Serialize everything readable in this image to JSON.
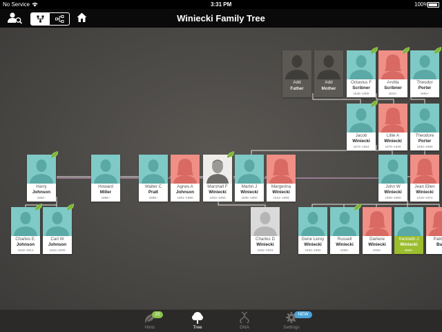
{
  "status_bar": {
    "carrier": "No Service",
    "time": "3:31 PM",
    "battery": "100%"
  },
  "nav": {
    "title": "Winiecki Family Tree",
    "icons": [
      "person-search-icon",
      "tree-view-icon",
      "family-view-icon",
      "home-icon"
    ]
  },
  "colors": {
    "male": "#7fc9c6",
    "female": "#ef8f86",
    "unknown": "#dadada",
    "add": "#5c5955",
    "highlight": "#9bbd2e",
    "hint_badge": "#8bc34a",
    "new_badge": "#4aa3d8"
  },
  "people": {
    "add_father": {
      "first": "Add",
      "last": "Father",
      "years": "",
      "kind": "add"
    },
    "add_mother": {
      "first": "Add",
      "last": "Mother",
      "years": "",
      "kind": "add"
    },
    "octavius": {
      "first": "Octavius F",
      "last": "Scribner",
      "years": "1846–1908",
      "kind": "male",
      "leaf": true
    },
    "arvilla": {
      "first": "Arvilla",
      "last": "Scribner",
      "years": "1843–",
      "kind": "female",
      "leaf": true
    },
    "theodor": {
      "first": "Theodor",
      "last": "Porter",
      "years": "1860–",
      "kind": "male",
      "leaf": true
    },
    "jacob": {
      "first": "Jacob",
      "last": "Winiecki",
      "years": "1874–1954",
      "kind": "male",
      "leaf": true
    },
    "lillie": {
      "first": "Lillie A",
      "last": "Winiecki",
      "years": "1878–1946",
      "kind": "female"
    },
    "theodore": {
      "first": "Theodore",
      "last": "Porter",
      "years": "1893–1966",
      "kind": "male"
    },
    "harry": {
      "first": "Harry",
      "last": "Johnson",
      "years": "1892–",
      "kind": "male",
      "leaf": true
    },
    "howard": {
      "first": "Howard",
      "last": "Miller",
      "years": "1896–",
      "kind": "male"
    },
    "walter": {
      "first": "Walter C",
      "last": "Pratt",
      "years": "1898–",
      "kind": "male"
    },
    "agnes": {
      "first": "Agnes A",
      "last": "Johnson",
      "years": "1901–1990",
      "kind": "female"
    },
    "marshall": {
      "first": "Marshall F",
      "last": "Winiecki",
      "years": "1903–1990",
      "kind": "photo",
      "leaf": true
    },
    "martin": {
      "first": "Martin J",
      "last": "Winiecki",
      "years": "1906–1960",
      "kind": "male"
    },
    "margerina": {
      "first": "Margerina",
      "last": "Winiecki",
      "years": "1914–1989",
      "kind": "female"
    },
    "john": {
      "first": "John W",
      "last": "Winiecki",
      "years": "1909–1980",
      "kind": "male"
    },
    "jean": {
      "first": "Jean Ellen",
      "last": "Winiecki",
      "years": "1919–1974",
      "kind": "female"
    },
    "charles_e": {
      "first": "Charles E.",
      "last": "Johnson",
      "years": "1919–2012",
      "kind": "male",
      "leaf": true
    },
    "carl": {
      "first": "Carl W",
      "last": "Johnson",
      "years": "1923–2000",
      "kind": "male",
      "leaf": true
    },
    "charles_d": {
      "first": "Charles D",
      "last": "Winiecki",
      "years": "1932–1933",
      "kind": "unknown"
    },
    "gene": {
      "first": "Gene Leroy",
      "last": "Winiecki",
      "years": "1932–1950",
      "kind": "male"
    },
    "russell": {
      "first": "Russell",
      "last": "Winiecki",
      "years": "1935–",
      "kind": "male",
      "leaf": true
    },
    "darlene": {
      "first": "Darlene",
      "last": "Winiecki",
      "years": "1938–",
      "kind": "female"
    },
    "kenneth": {
      "first": "Kenneth J",
      "last": "Winiecki",
      "years": "1948–",
      "kind": "highlight"
    },
    "patricia": {
      "first": "Patricia",
      "last": "Bus",
      "years": "",
      "kind": "female"
    }
  },
  "tabs": [
    {
      "label": "Hints",
      "icon": "leaf-icon",
      "badge": "22",
      "active": false
    },
    {
      "label": "Tree",
      "icon": "tree-icon",
      "badge": "",
      "active": true
    },
    {
      "label": "DNA",
      "icon": "dna-icon",
      "badge": "",
      "active": false
    },
    {
      "label": "Settings",
      "icon": "gear-icon",
      "badge": "NEW",
      "active": false
    }
  ]
}
